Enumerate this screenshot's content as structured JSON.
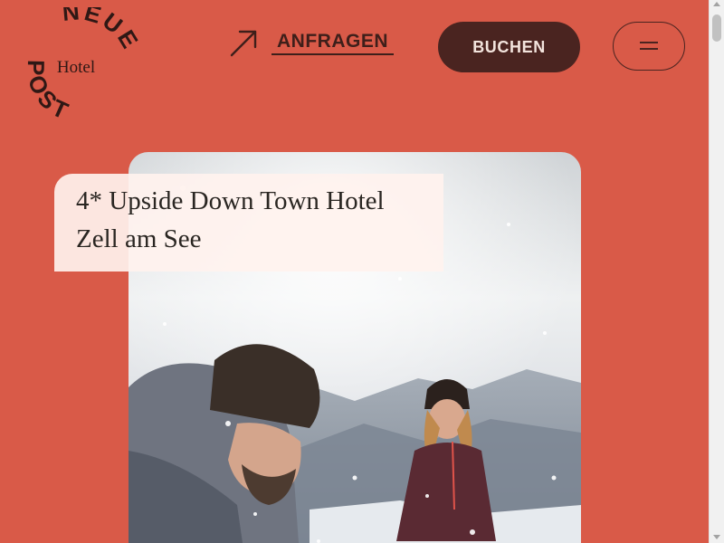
{
  "logo": {
    "word_top": "NEUE",
    "word_center": "Hotel",
    "word_bottom": "POST"
  },
  "header": {
    "inquiry_label": "ANFRAGEN",
    "inquiry_icon": "arrow-up-right-icon",
    "book_label": "BUCHEN",
    "menu_icon": "hamburger-menu-icon"
  },
  "hero": {
    "title_line1": "4* Upside Down Town Hotel",
    "title_line2": "Zell am See"
  },
  "colors": {
    "background": "#d95a48",
    "dark_brown": "#4a2420",
    "title_card": "#fff2ee"
  }
}
